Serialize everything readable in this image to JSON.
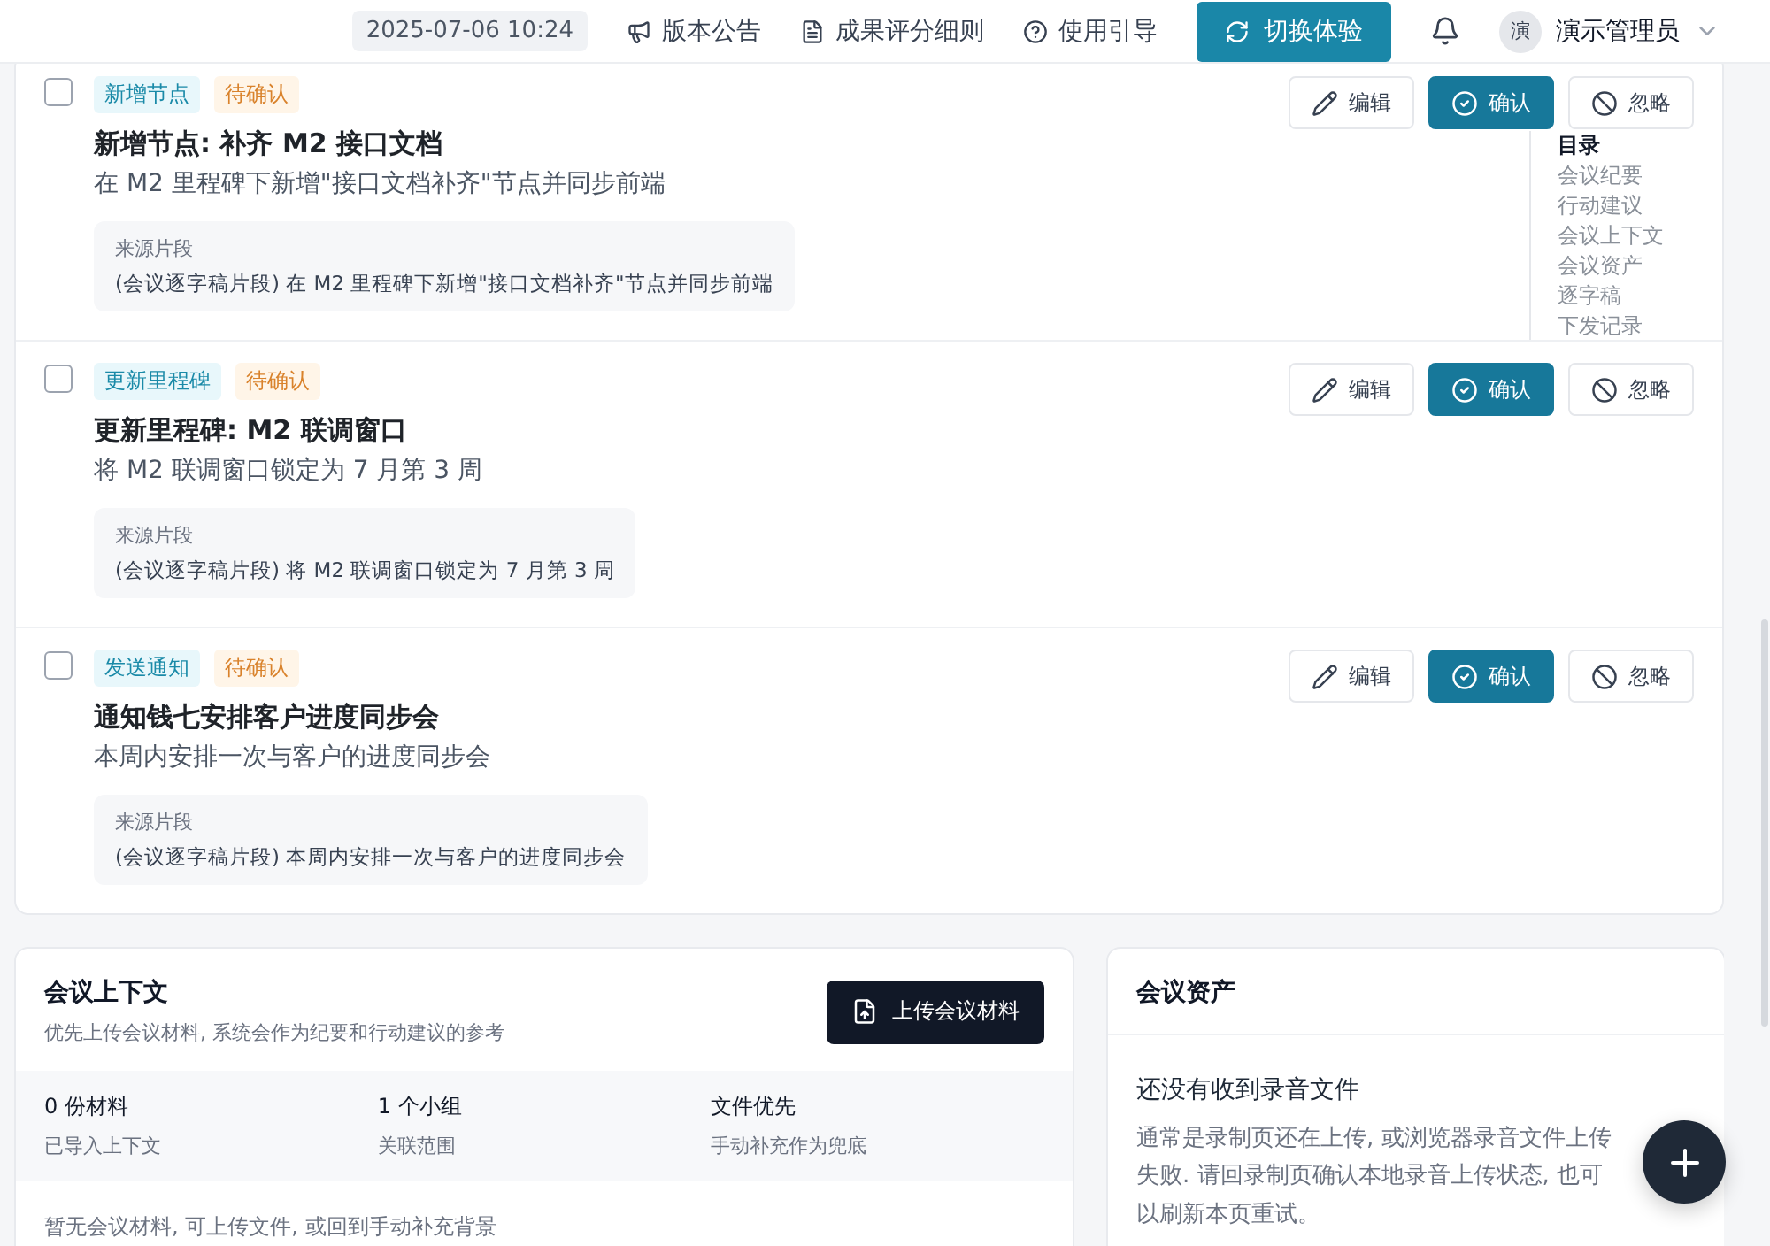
{
  "header": {
    "datetime": "2025-07-06 10:24",
    "links": [
      {
        "kind": "announce",
        "label": "版本公告"
      },
      {
        "kind": "rules",
        "label": "成果评分细则"
      },
      {
        "kind": "guide",
        "label": "使用引导"
      }
    ],
    "switch_button": "切换体验",
    "user": {
      "avatar_text": "演",
      "name": "演示管理员"
    }
  },
  "actions": [
    {
      "checked": false,
      "type_tag": "新增节点",
      "status_tag": "待确认",
      "title": "新增节点: 补齐 M2 接口文档",
      "description": "在 M2 里程碑下新增\"接口文档补齐\"节点并同步前端",
      "source_label": "来源片段",
      "source_text": "(会议逐字稿片段) 在 M2 里程碑下新增\"接口文档补齐\"节点并同步前端",
      "buttons": [
        {
          "kind": "edit",
          "label": "编辑"
        },
        {
          "kind": "confirm",
          "label": "确认"
        },
        {
          "kind": "ignore",
          "label": "忽略"
        }
      ]
    },
    {
      "checked": false,
      "type_tag": "更新里程碑",
      "status_tag": "待确认",
      "title": "更新里程碑: M2 联调窗口",
      "description": "将 M2 联调窗口锁定为 7 月第 3 周",
      "source_label": "来源片段",
      "source_text": "(会议逐字稿片段) 将 M2 联调窗口锁定为 7 月第 3 周",
      "buttons": [
        {
          "kind": "edit",
          "label": "编辑"
        },
        {
          "kind": "confirm",
          "label": "确认"
        },
        {
          "kind": "ignore",
          "label": "忽略"
        }
      ]
    },
    {
      "checked": false,
      "type_tag": "发送通知",
      "status_tag": "待确认",
      "title": "通知钱七安排客户进度同步会",
      "description": "本周内安排一次与客户的进度同步会",
      "source_label": "来源片段",
      "source_text": "(会议逐字稿片段) 本周内安排一次与客户的进度同步会",
      "buttons": [
        {
          "kind": "edit",
          "label": "编辑"
        },
        {
          "kind": "confirm",
          "label": "确认"
        },
        {
          "kind": "ignore",
          "label": "忽略"
        }
      ]
    }
  ],
  "toc": {
    "title": "目录",
    "items": [
      {
        "label": "会议纪要"
      },
      {
        "label": "行动建议"
      },
      {
        "label": "会议上下文"
      },
      {
        "label": "会议资产"
      },
      {
        "label": "逐字稿"
      },
      {
        "label": "下发记录"
      }
    ]
  },
  "context": {
    "title": "会议上下文",
    "subtitle": "优先上传会议材料, 系统会作为纪要和行动建议的参考",
    "upload_button": "上传会议材料",
    "stats": [
      {
        "value": "0 份材料",
        "label": "已导入上下文"
      },
      {
        "value": "1 个小组",
        "label": "关联范围"
      },
      {
        "value": "文件优先",
        "label": "手动补充作为兜底"
      }
    ],
    "empty_text": "暂无会议材料, 可上传文件, 或回到手动补充背景"
  },
  "assets": {
    "title": "会议资产",
    "empty_title": "还没有收到录音文件",
    "empty_text": "通常是录制页还在上传, 或浏览器录音文件上传失败. 请回录制页确认本地录音上传状态, 也可以刷新本页重试。"
  }
}
